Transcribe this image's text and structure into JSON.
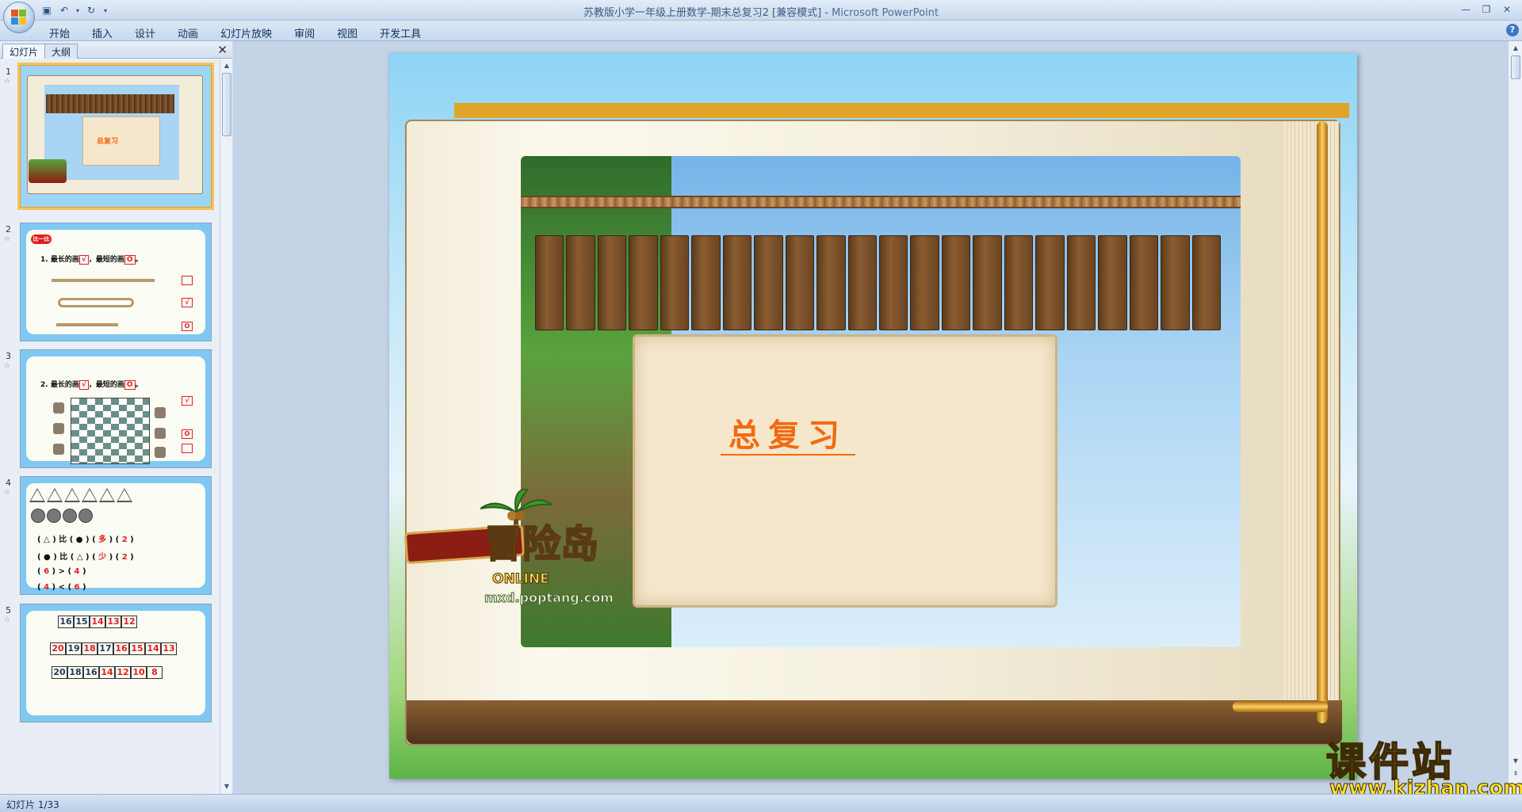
{
  "window": {
    "title": "苏教版小学一年级上册数学-期末总复习2 [兼容模式]",
    "separator": " - ",
    "app_name": "Microsoft PowerPoint"
  },
  "ribbon": {
    "tabs": [
      "开始",
      "插入",
      "设计",
      "动画",
      "幻灯片放映",
      "审阅",
      "视图",
      "开发工具"
    ],
    "help": "?"
  },
  "left_panel": {
    "tab_slides": "幻灯片",
    "tab_outline": "大纲",
    "close": "✕"
  },
  "thumbnails": [
    {
      "num": "1",
      "title": "总复习",
      "selected": true
    },
    {
      "num": "2",
      "badge": "比一比",
      "line1": "1. 最长的画",
      "line1b": "，最短的画",
      "mark_check": "√",
      "mark_circle": "O",
      "period": "。"
    },
    {
      "num": "3",
      "line1": "2. 最长的画",
      "line1b": "，最短的画",
      "mark_check": "√",
      "mark_circle": "O",
      "period": "。"
    },
    {
      "num": "4",
      "row1": "( △ ) 比 ( ● )",
      "row1_ans": "多",
      "row1_n": "2",
      "row2": "( ● ) 比 ( △ )",
      "row2_ans": "少",
      "row2_n": "2",
      "row3_a": "6",
      "row3_op": ">",
      "row3_b": "4",
      "row4_a": "4",
      "row4_op": "<",
      "row4_b": "6"
    },
    {
      "num": "5",
      "r1": [
        "16",
        "15",
        "14",
        "13",
        "12"
      ],
      "r2": [
        "20",
        "19",
        "18",
        "17",
        "16",
        "15",
        "14",
        "13"
      ],
      "r3": [
        "20",
        "18",
        "16",
        "14",
        "12",
        "10",
        "8"
      ]
    }
  ],
  "slide": {
    "title": "总复习",
    "logo_text": "冒险岛",
    "logo_online": "ONLINE",
    "logo_url": "mxd.poptang.com"
  },
  "watermark": {
    "text": "课件站",
    "url": "www.kjzhan.com"
  },
  "status": {
    "slide_counter": "幻灯片 1/33"
  },
  "colors": {
    "accent_orange": "#f26a10",
    "top_bar": "#e0a42b",
    "selected_outline": "#f7c25c"
  }
}
